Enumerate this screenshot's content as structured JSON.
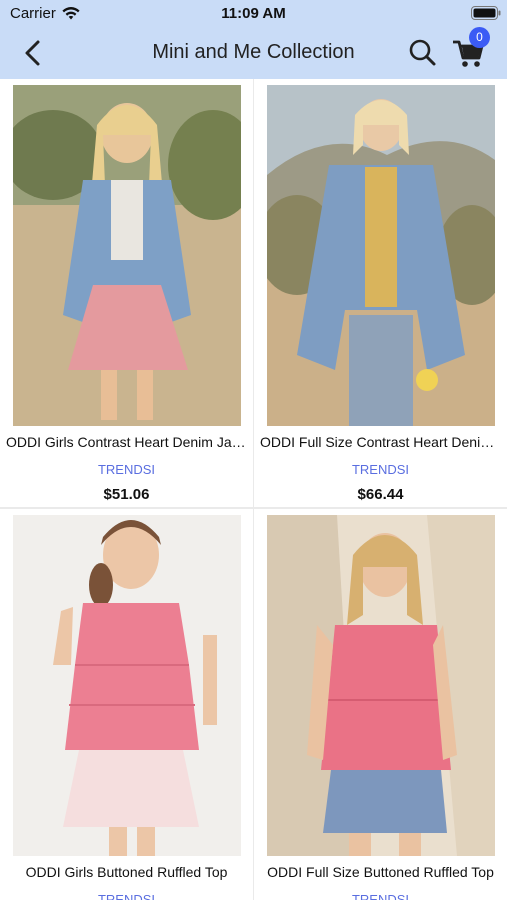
{
  "status_bar": {
    "carrier": "Carrier",
    "time": "11:09 AM",
    "icons": [
      "wifi-icon",
      "battery-icon"
    ]
  },
  "nav": {
    "title": "Mini and Me Collection",
    "back_icon": "chevron-left-icon",
    "search_icon": "search-icon",
    "cart_icon": "cart-icon",
    "cart_count": "0"
  },
  "products": [
    {
      "name": "ODDI Girls Contrast Heart Denim Jacket",
      "brand": "TRENDSI",
      "price": "$51.06"
    },
    {
      "name": "ODDI Full Size Contrast Heart Denim Jacket",
      "brand": "TRENDSI",
      "price": "$66.44"
    },
    {
      "name": "ODDI Girls Buttoned Ruffled Top",
      "brand": "TRENDSI",
      "price": ""
    },
    {
      "name": "ODDI Full Size Buttoned Ruffled Top",
      "brand": "TRENDSI",
      "price": ""
    }
  ],
  "colors": {
    "header_bg": "#c9dcf7",
    "brand_text": "#5a6ee0",
    "badge": "#3b5bf5"
  }
}
